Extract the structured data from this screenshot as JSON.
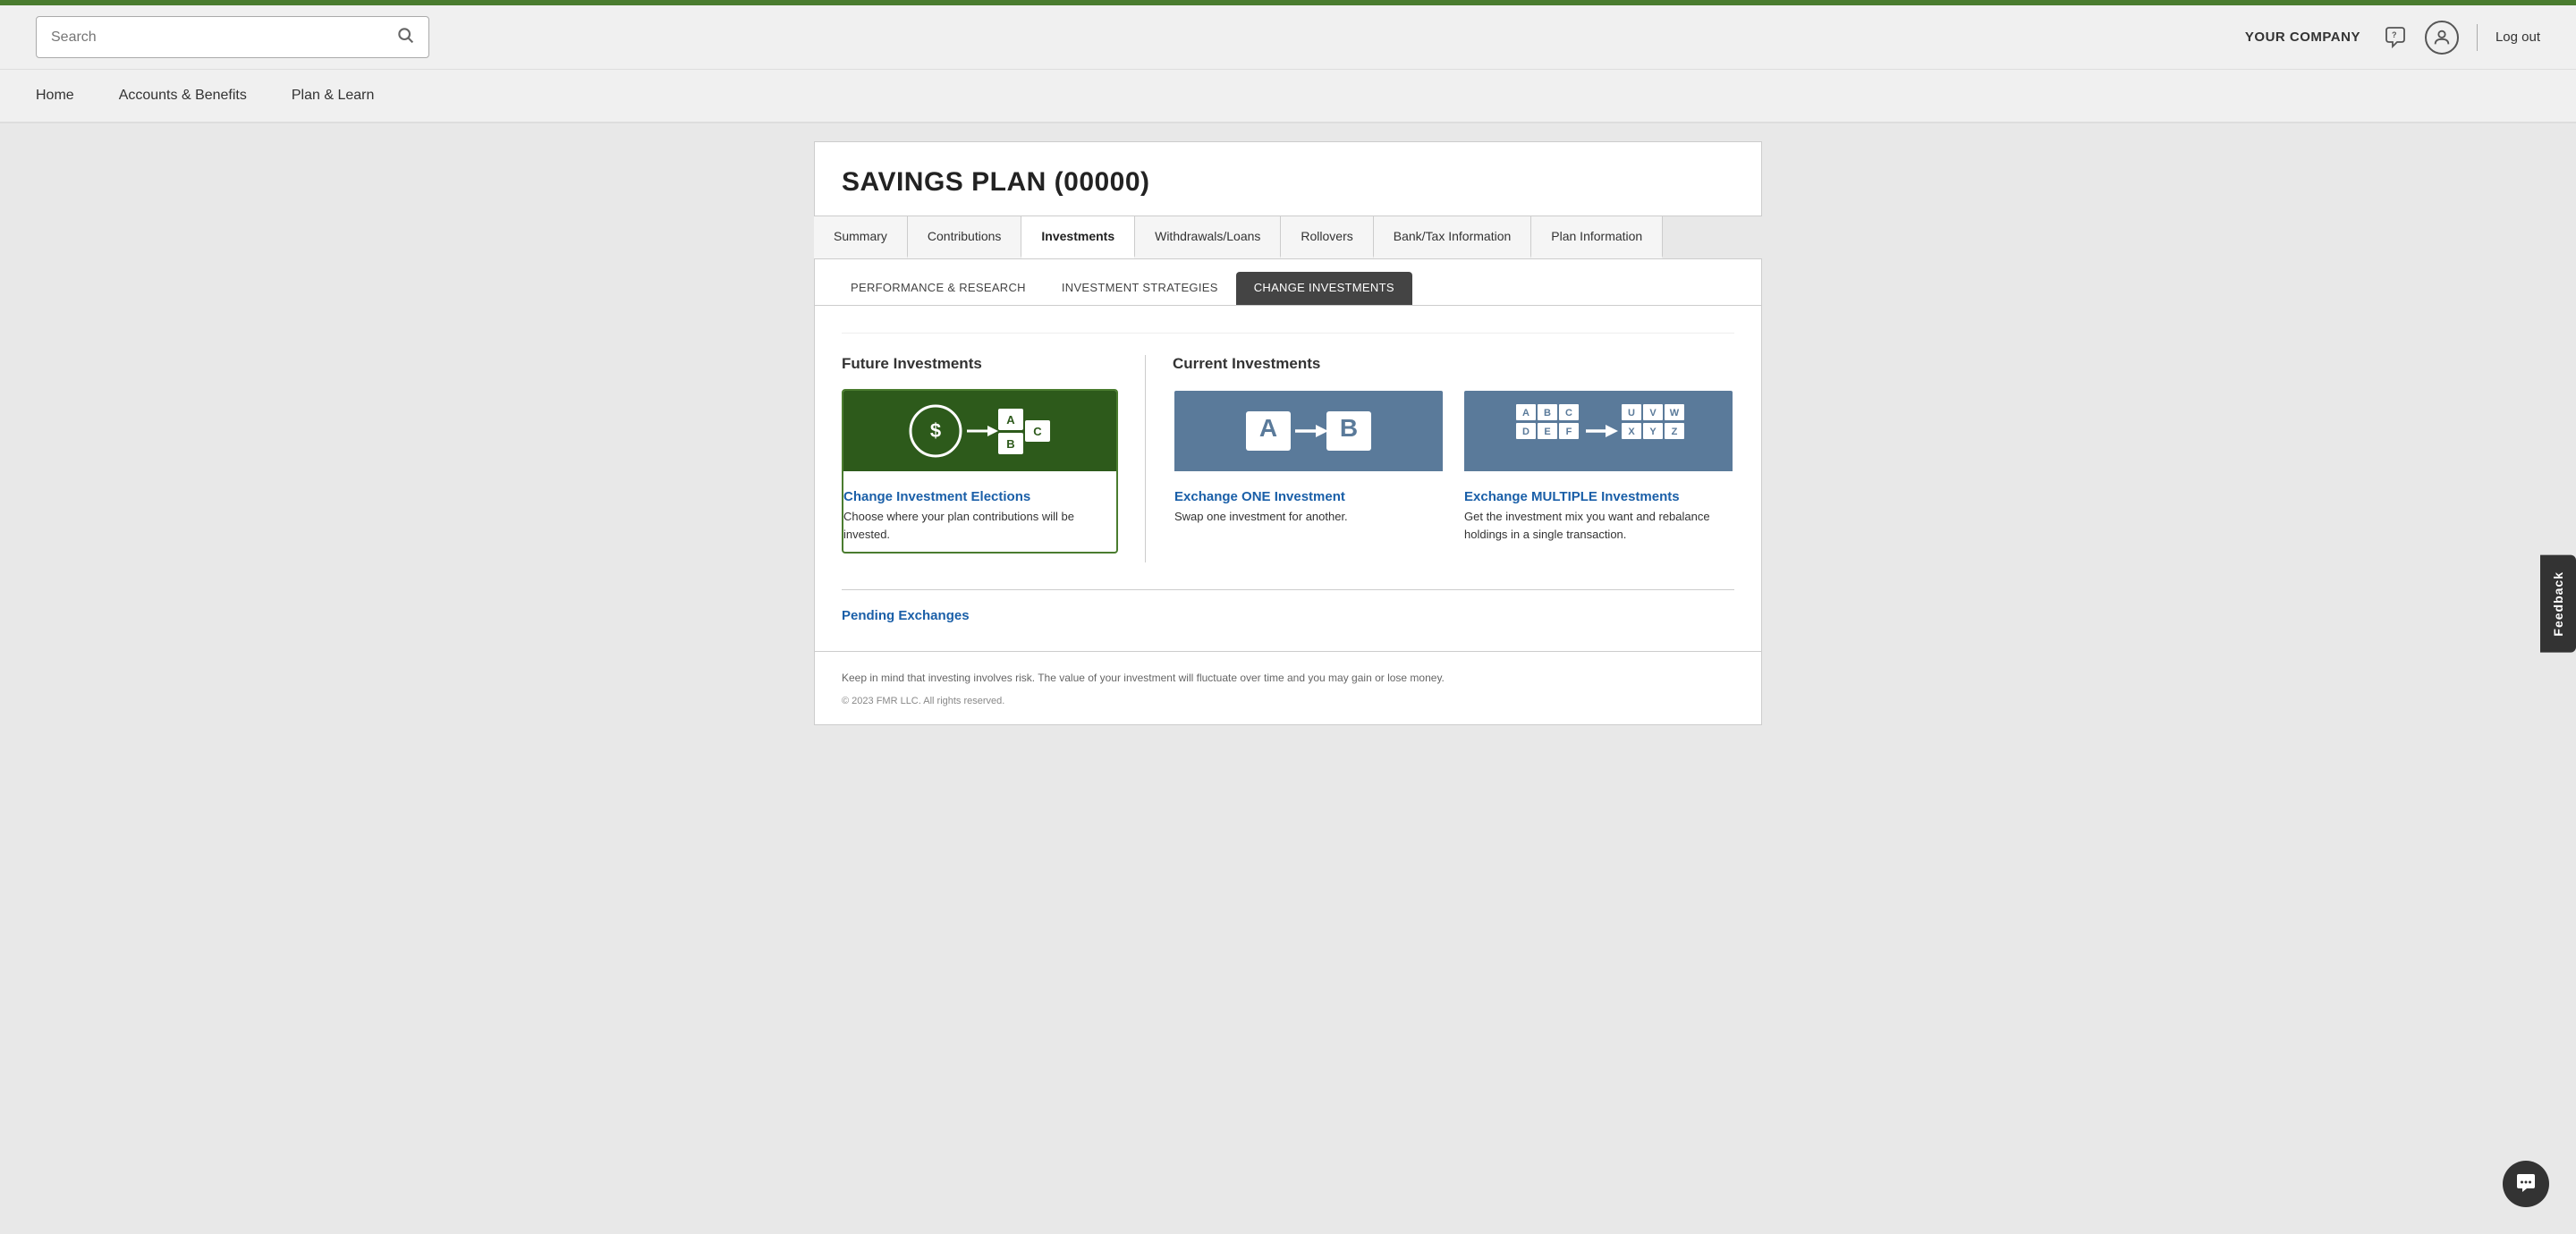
{
  "topbar": {
    "color": "#4a7c2f"
  },
  "header": {
    "search_placeholder": "Search",
    "company_name": "YOUR COMPANY",
    "logout_label": "Log out"
  },
  "nav": {
    "items": [
      {
        "label": "Home",
        "id": "home"
      },
      {
        "label": "Accounts & Benefits",
        "id": "accounts-benefits"
      },
      {
        "label": "Plan & Learn",
        "id": "plan-learn"
      }
    ]
  },
  "plan": {
    "title": "SAVINGS PLAN (00000)"
  },
  "tabs": [
    {
      "label": "Summary",
      "id": "summary",
      "active": false
    },
    {
      "label": "Contributions",
      "id": "contributions",
      "active": false
    },
    {
      "label": "Investments",
      "id": "investments",
      "active": true
    },
    {
      "label": "Withdrawals/Loans",
      "id": "withdrawals",
      "active": false
    },
    {
      "label": "Rollovers",
      "id": "rollovers",
      "active": false
    },
    {
      "label": "Bank/Tax Information",
      "id": "bank-tax",
      "active": false
    },
    {
      "label": "Plan Information",
      "id": "plan-info",
      "active": false
    }
  ],
  "sub_tabs": [
    {
      "label": "PERFORMANCE & RESEARCH",
      "id": "performance",
      "active": false
    },
    {
      "label": "INVESTMENT STRATEGIES",
      "id": "strategies",
      "active": false
    },
    {
      "label": "CHANGE INVESTMENTS",
      "id": "change",
      "active": true
    }
  ],
  "future_investments": {
    "section_title": "Future Investments",
    "card": {
      "title": "Change Investment Elections",
      "description": "Choose where your plan contributions will be invested.",
      "selected": true
    }
  },
  "current_investments": {
    "section_title": "Current Investments",
    "cards": [
      {
        "id": "exchange-one",
        "title": "Exchange ONE Investment",
        "description": "Swap one investment for another."
      },
      {
        "id": "exchange-multiple",
        "title": "Exchange MULTIPLE Investments",
        "description": "Get the investment mix you want and rebalance holdings in a single transaction."
      }
    ]
  },
  "pending": {
    "label": "Pending Exchanges"
  },
  "disclaimer": {
    "text": "Keep in mind that investing involves risk. The value of your investment will fluctuate over time and you may gain or lose money.",
    "copyright": "© 2023 FMR LLC. All rights reserved."
  },
  "feedback": {
    "label": "Feedback"
  },
  "chat": {
    "icon": "💬"
  }
}
